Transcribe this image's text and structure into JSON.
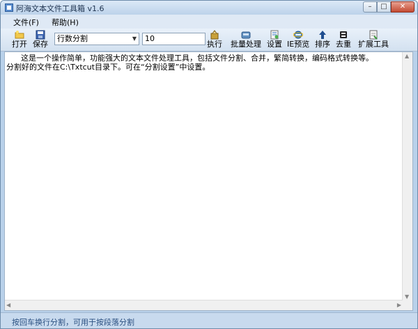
{
  "window": {
    "title": "阿海文本文件工具箱 v1.6",
    "min": "–",
    "max": "□",
    "close": "✕"
  },
  "menu": {
    "items": [
      "文件(F)",
      "帮助(H)"
    ]
  },
  "toolbar": {
    "open": "打开",
    "save": "保存",
    "mode_select": "行数分割",
    "count_value": "10",
    "execute": "执行",
    "batch": "批量处理",
    "settings": "设置",
    "ie_preview": "IE预览",
    "sort": "排序",
    "dedupe": "去重",
    "extend": "扩展工具"
  },
  "editor": {
    "text": "      这是一个操作简单，功能强大的文本文件处理工具，包括文件分割、合并，繁简转换，编码格式转换等。\n分割好的文件在C:\\Txtcut目录下。可在“分割设置”中设置。"
  },
  "status": {
    "text": "按回车换行分割，可用于按段落分割"
  }
}
